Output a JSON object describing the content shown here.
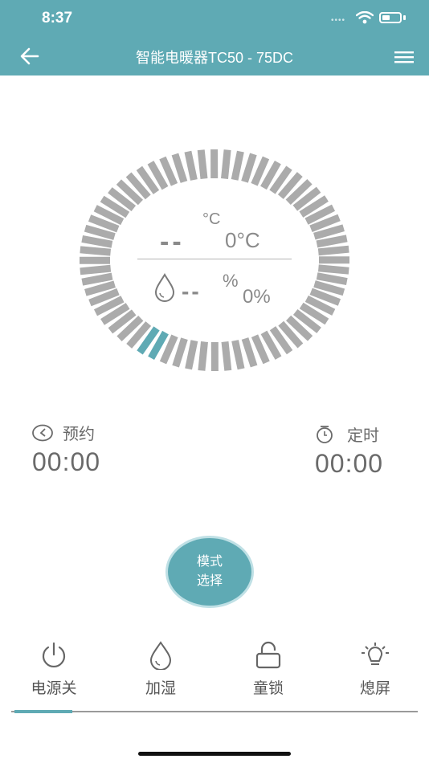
{
  "status_bar": {
    "time": "8:37",
    "signal": "••••"
  },
  "header": {
    "title": "智能电暖器TC50 - 75DC"
  },
  "dial": {
    "total_segments": 64,
    "active_segments": 2,
    "accent": "#5faab4",
    "inactive": "#ababab",
    "temp_dashes": "--",
    "temp_unit": "°C",
    "temp_value": "0°C",
    "humidity_dashes": "--",
    "humidity_unit": "%",
    "humidity_value": "0%"
  },
  "schedule": {
    "label": "预约",
    "value": "00:00"
  },
  "timer": {
    "label": "定时",
    "value": "00:00"
  },
  "mode_button": {
    "line1": "模式",
    "line2": "选择"
  },
  "bottom_bar": {
    "power": "电源关",
    "humidify": "加湿",
    "child_lock": "童锁",
    "screen_off": "熄屏",
    "active_index": 0
  },
  "colors": {
    "accent": "#5faab4",
    "text": "#6b6b6b",
    "divider": "#9a9a9a"
  }
}
